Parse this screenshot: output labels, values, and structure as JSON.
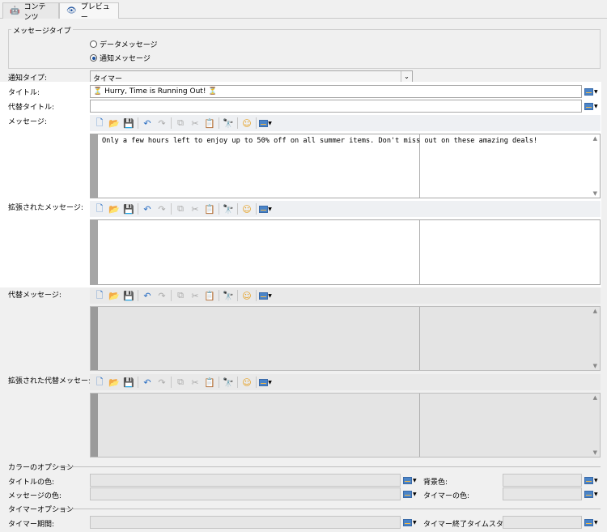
{
  "tabs": [
    {
      "label": "コンテンツ",
      "icon": "android-icon"
    },
    {
      "label": "プレビュー",
      "icon": "eye-icon"
    }
  ],
  "message_type": {
    "legend": "メッセージタイプ",
    "options": [
      {
        "label": "データメッセージ",
        "selected": false
      },
      {
        "label": "通知メッセージ",
        "selected": true
      }
    ]
  },
  "notify_type": {
    "label": "通知タイプ:",
    "value": "タイマー"
  },
  "title": {
    "label": "タイトル:",
    "value": "⏳ Hurry, Time is Running Out! ⏳"
  },
  "alt_title": {
    "label": "代替タイトル:",
    "value": ""
  },
  "message": {
    "label": "メッセージ:",
    "value": "Only a few hours left to enjoy up to 50% off on all summer items. Don't miss out on these amazing deals!"
  },
  "expanded_message": {
    "label": "拡張されたメッセージ:",
    "value": ""
  },
  "alt_message": {
    "label": "代替メッセージ:",
    "value": ""
  },
  "expanded_alt_message": {
    "label": "拡張された代替メッセージ:",
    "value": ""
  },
  "color_options": {
    "legend": "カラーのオプション",
    "title_color": "タイトルの色:",
    "bg_color": "背景色:",
    "message_color": "メッセージの色:",
    "timer_color": "タイマーの色:"
  },
  "timer_options": {
    "legend": "タイマーオプション",
    "duration": "タイマー期間:",
    "end_timestamp": "タイマー終了タイムスタンプ:"
  },
  "colors": {
    "accent": "#1a4f9c",
    "toolbar_bg": "#e9e9e9",
    "disabled_bg": "#e4e4e4"
  }
}
